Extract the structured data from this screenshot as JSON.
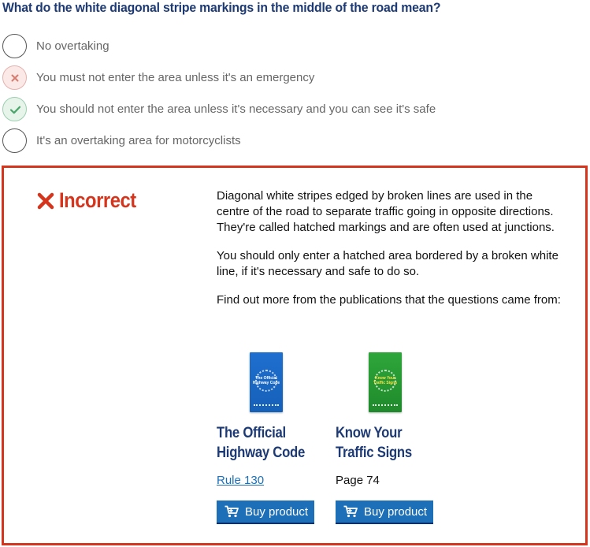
{
  "question": {
    "text": "What do the white diagonal stripe markings in the middle of the road mean?"
  },
  "options": [
    {
      "label": "No overtaking",
      "state": "unselected"
    },
    {
      "label": "You must not enter the area unless it's an emergency",
      "state": "incorrect-selected"
    },
    {
      "label": "You should not enter the area unless it's necessary and you can see it's safe",
      "state": "correct"
    },
    {
      "label": "It's an overtaking area for motorcyclists",
      "state": "unselected"
    }
  ],
  "feedback": {
    "verdict": "Incorrect",
    "paragraphs": [
      "Diagonal white stripes edged by broken lines are used in the centre of the road to separate traffic going in opposite directions. They're called hatched markings and are often used at junctions.",
      "You should only enter a hatched area bordered by a broken white line, if it's necessary and safe to do so.",
      "Find out more from the publications that the questions came from:"
    ],
    "publications": [
      {
        "title_line1": "The Official",
        "title_line2": "Highway Code",
        "reference": "Rule 130",
        "button": "Buy product",
        "cover_text": "The Official Highway Code"
      },
      {
        "title_line1": "Know Your",
        "title_line2": "Traffic Signs",
        "reference": "Page 74",
        "button": "Buy product",
        "cover_text": "Know Your Traffic Signs"
      }
    ]
  },
  "colors": {
    "incorrect": "#d4351c",
    "heading": "#1d3a74",
    "link": "#1d70b8",
    "button": "#1d70b8",
    "correct": "#3d9a5b"
  }
}
